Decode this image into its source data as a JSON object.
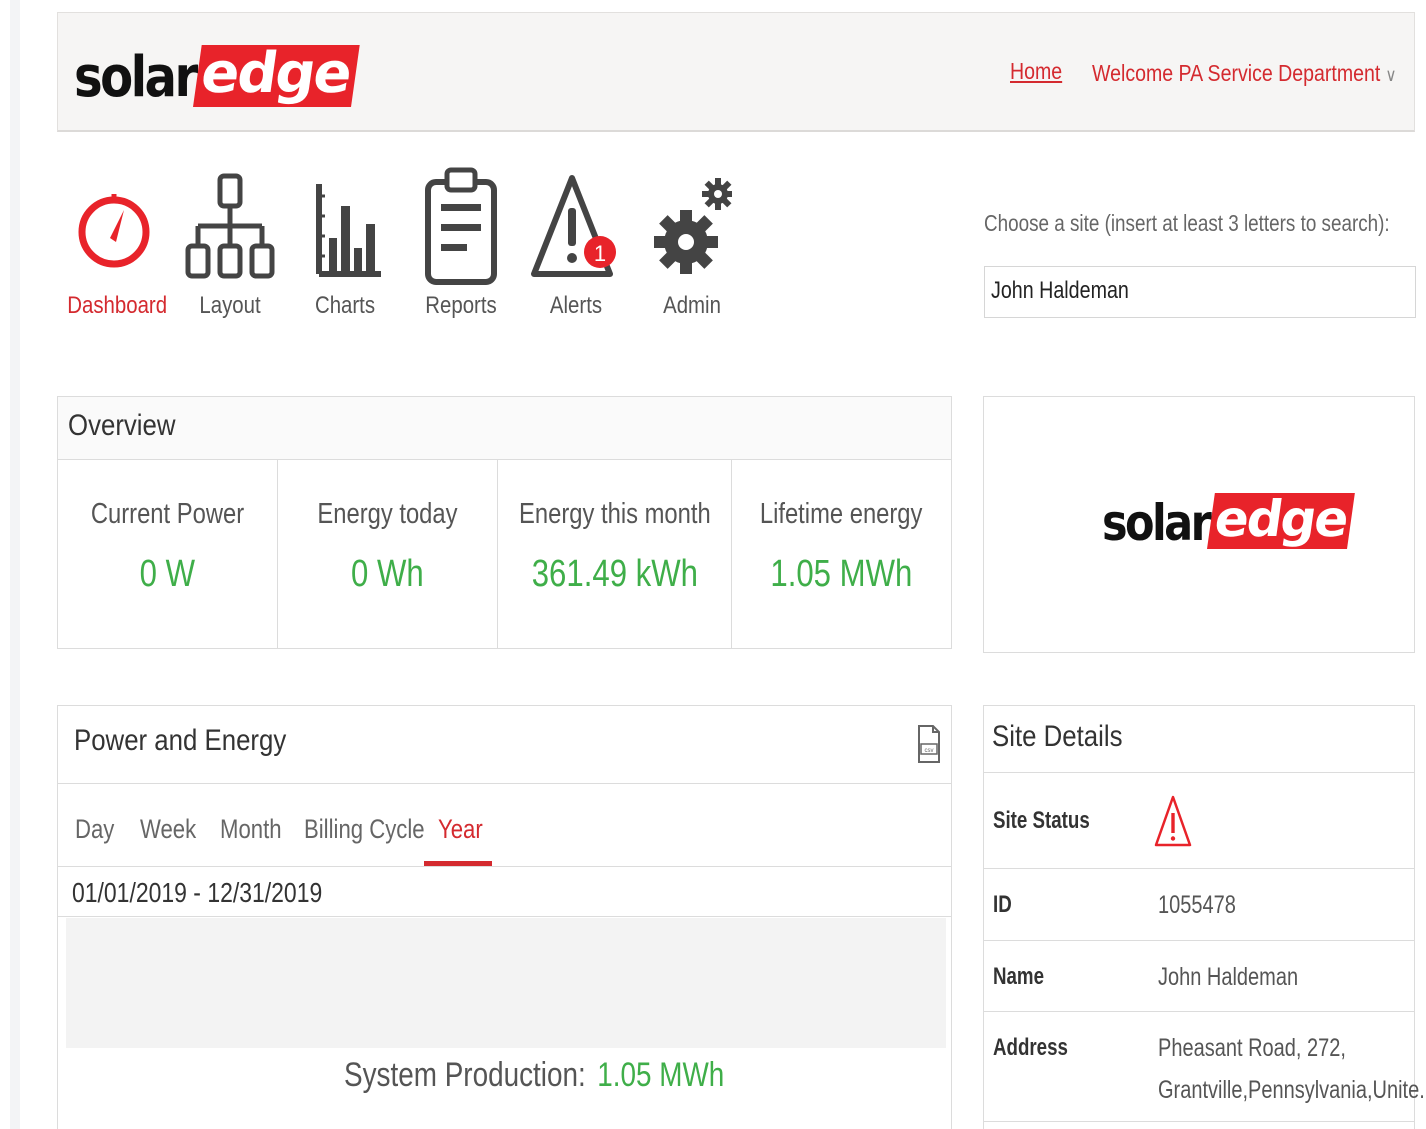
{
  "brand": {
    "solar": "solar",
    "edge": "edge",
    "accent": "#e8232a",
    "green": "#3fae49"
  },
  "header": {
    "home_label": "Home",
    "welcome_label": "Welcome PA Service Department"
  },
  "nav": {
    "items": [
      {
        "label": "Dashboard",
        "icon": "speedometer-icon",
        "active": true
      },
      {
        "label": "Layout",
        "icon": "sitemap-icon"
      },
      {
        "label": "Charts",
        "icon": "bar-chart-icon"
      },
      {
        "label": "Reports",
        "icon": "clipboard-icon"
      },
      {
        "label": "Alerts",
        "icon": "warning-icon",
        "badge": "1"
      },
      {
        "label": "Admin",
        "icon": "gears-icon"
      }
    ]
  },
  "site_search": {
    "label": "Choose a site (insert at least 3 letters to search):",
    "value": "John Haldeman"
  },
  "overview": {
    "title": "Overview",
    "metrics": [
      {
        "label": "Current Power",
        "value": "0 W"
      },
      {
        "label": "Energy today",
        "value": "0 Wh"
      },
      {
        "label": "Energy this month",
        "value": "361.49 kWh"
      },
      {
        "label": "Lifetime energy",
        "value": "1.05 MWh"
      }
    ]
  },
  "power_energy": {
    "title": "Power and Energy",
    "tabs": [
      "Day",
      "Week",
      "Month",
      "Billing Cycle",
      "Year"
    ],
    "active_tab": "Year",
    "date_range": "01/01/2019 - 12/31/2019",
    "system_production_label": "System Production:",
    "system_production_value": "1.05 MWh",
    "csv_icon": "csv-file-icon"
  },
  "site_details": {
    "title": "Site Details",
    "rows": [
      {
        "key": "Site Status",
        "icon": "warning-outline-icon"
      },
      {
        "key": "ID",
        "value": "1055478"
      },
      {
        "key": "Name",
        "value": "John Haldeman"
      },
      {
        "key": "Address",
        "value_line1": "Pheasant Road, 272,",
        "value_line2": "Grantville,Pennsylvania,Unite..."
      }
    ]
  }
}
